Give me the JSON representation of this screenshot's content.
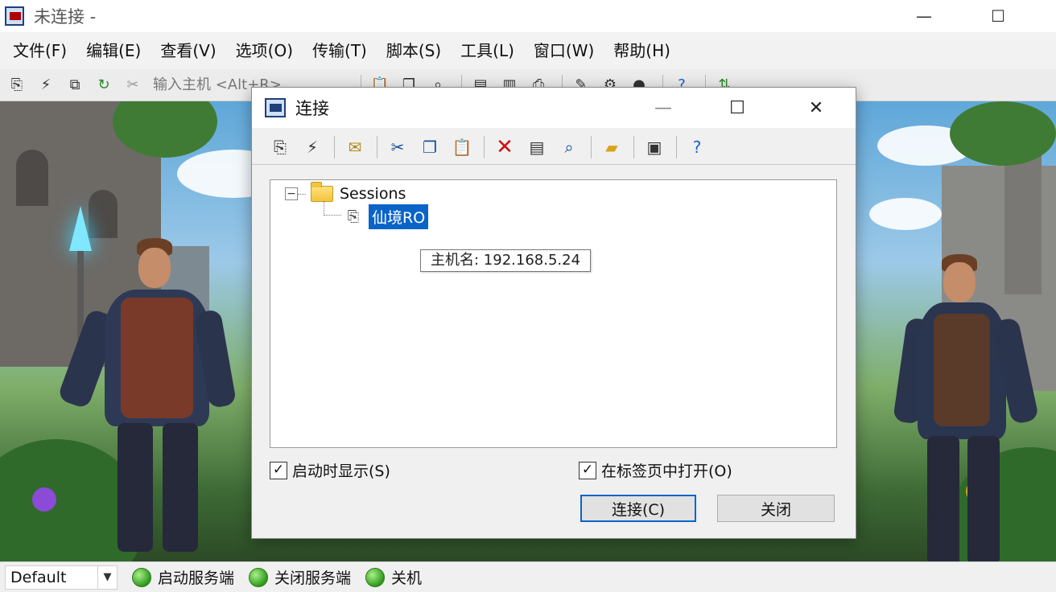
{
  "window": {
    "title": "未连接 -",
    "minimize": "—",
    "maximize": "☐"
  },
  "menu": [
    {
      "label": "文件(F)"
    },
    {
      "label": "编辑(E)"
    },
    {
      "label": "查看(V)"
    },
    {
      "label": "选项(O)"
    },
    {
      "label": "传输(T)"
    },
    {
      "label": "脚本(S)"
    },
    {
      "label": "工具(L)"
    },
    {
      "label": "窗口(W)"
    },
    {
      "label": "帮助(H)"
    }
  ],
  "toolbar": {
    "quick_connect_placeholder": "输入主机 <Alt+R>",
    "icons": [
      "connect-icon",
      "quick-connect-icon",
      "connect-tab-icon",
      "reconnect-icon",
      "disconnect-icon",
      "paste-icon",
      "copy-icon",
      "find-icon",
      "session-options-icon",
      "global-options-icon",
      "print-icon",
      "log-icon",
      "key-icon",
      "map-icon",
      "help-icon",
      "sftp-icon"
    ]
  },
  "dialog": {
    "title": "连接",
    "minimize": "—",
    "maximize": "☐",
    "close": "✕",
    "toolbar_icons": [
      "quick-connect-icon",
      "connect-in-tab-icon",
      "new-session-icon",
      "cut-icon",
      "copy-icon",
      "paste-icon",
      "delete-icon",
      "properties-icon",
      "find-icon",
      "new-folder-icon",
      "terminal-icon",
      "help-icon"
    ],
    "tree": {
      "root": {
        "label": "Sessions",
        "expander": "−"
      },
      "children": [
        {
          "label": "仙境RO",
          "selected": true
        }
      ]
    },
    "tooltip": "主机名: 192.168.5.24",
    "show_on_startup": {
      "label": "启动时显示(S)",
      "checked": true,
      "mark": "✓"
    },
    "open_in_tab": {
      "label": "在标签页中打开(O)",
      "checked": true,
      "mark": "✓"
    },
    "connect_button": "连接(C)",
    "close_button": "关闭"
  },
  "statusbar": {
    "profile": "Default",
    "dropdown_arrow": "▼",
    "buttons": [
      {
        "label": "启动服务端"
      },
      {
        "label": "关闭服务端"
      },
      {
        "label": "关机"
      }
    ]
  },
  "colors": {
    "selection": "#0a64c8",
    "status_green": "#2f9a1c"
  }
}
